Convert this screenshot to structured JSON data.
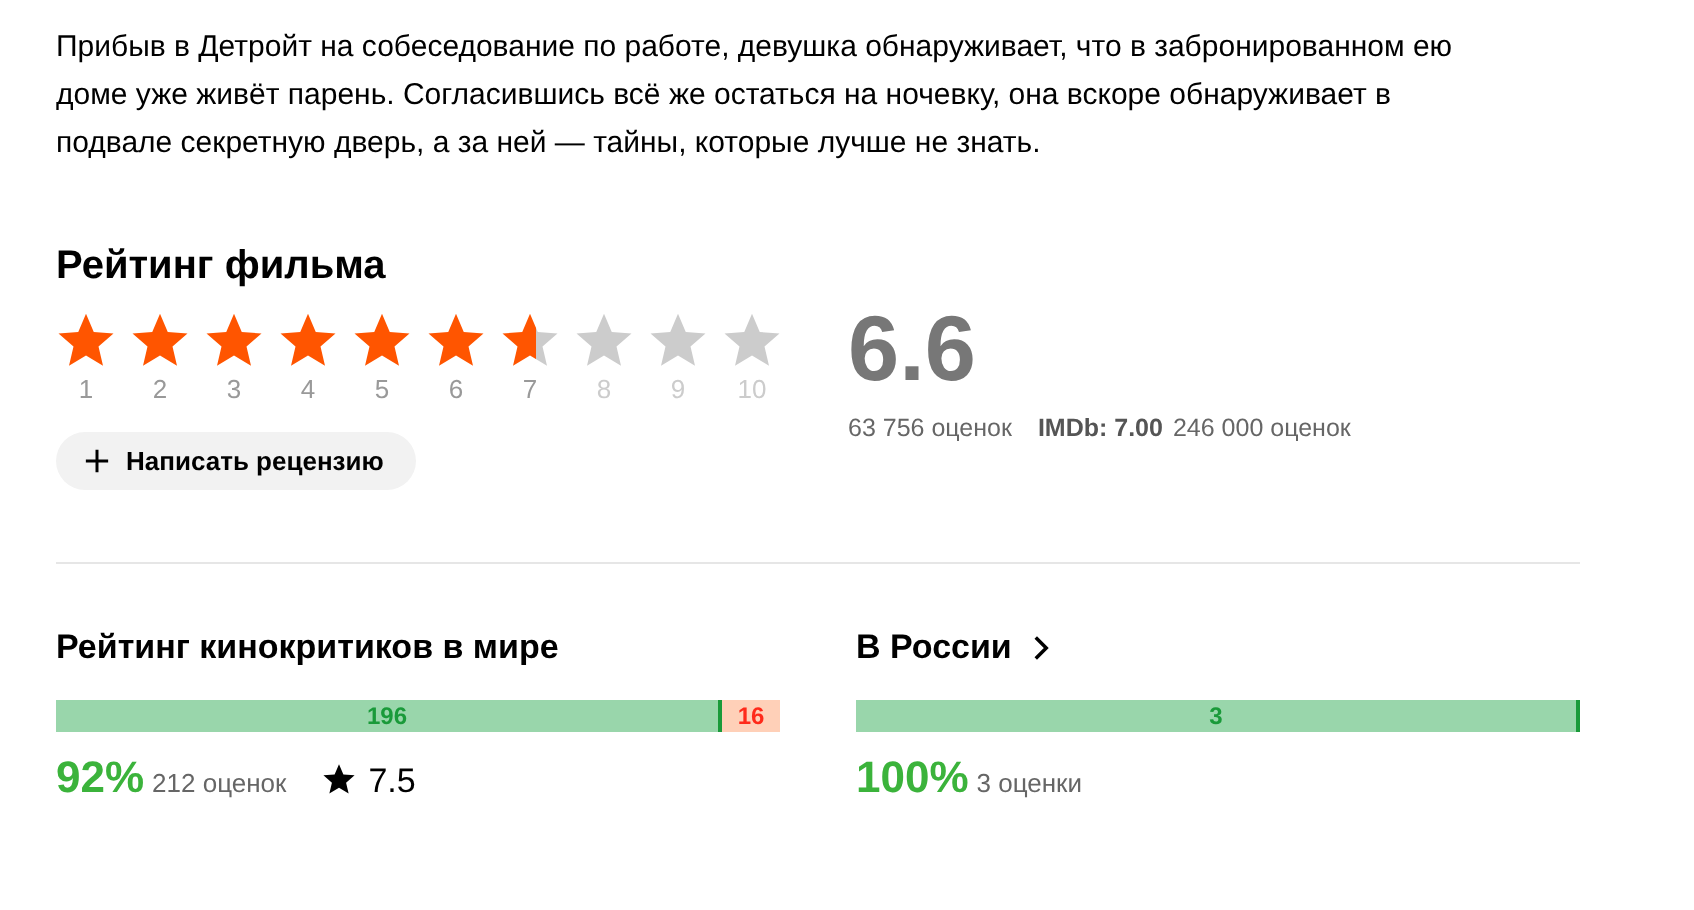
{
  "description": "Прибыв в Детройт на собеседование по работе, девушка обнаруживает, что в забронированном ею доме уже живёт парень. Согласившись всё же остаться на ночевку, она вскоре обнаруживает в подвале секретную дверь, а за ней — тайны, которые лучше не знать.",
  "rating": {
    "title": "Рейтинг фильма",
    "stars": 6.6,
    "star_labels": [
      "1",
      "2",
      "3",
      "4",
      "5",
      "6",
      "7",
      "8",
      "9",
      "10"
    ],
    "score": "6.6",
    "votes": "63 756 оценок",
    "imdb_label": "IMDb: 7.00",
    "imdb_votes": "246 000 оценок",
    "review_button": "Написать рецензию"
  },
  "critics": [
    {
      "title": "Рейтинг кинокритиков в мире",
      "link": false,
      "level": 0.92,
      "positive": "196",
      "negative": "16",
      "percent": "92%",
      "votes": "212 оценок",
      "average": "7.5"
    },
    {
      "title": "В России",
      "link": true,
      "level": 1,
      "positive": "3",
      "percent": "100%",
      "votes": "3 оценки"
    }
  ]
}
